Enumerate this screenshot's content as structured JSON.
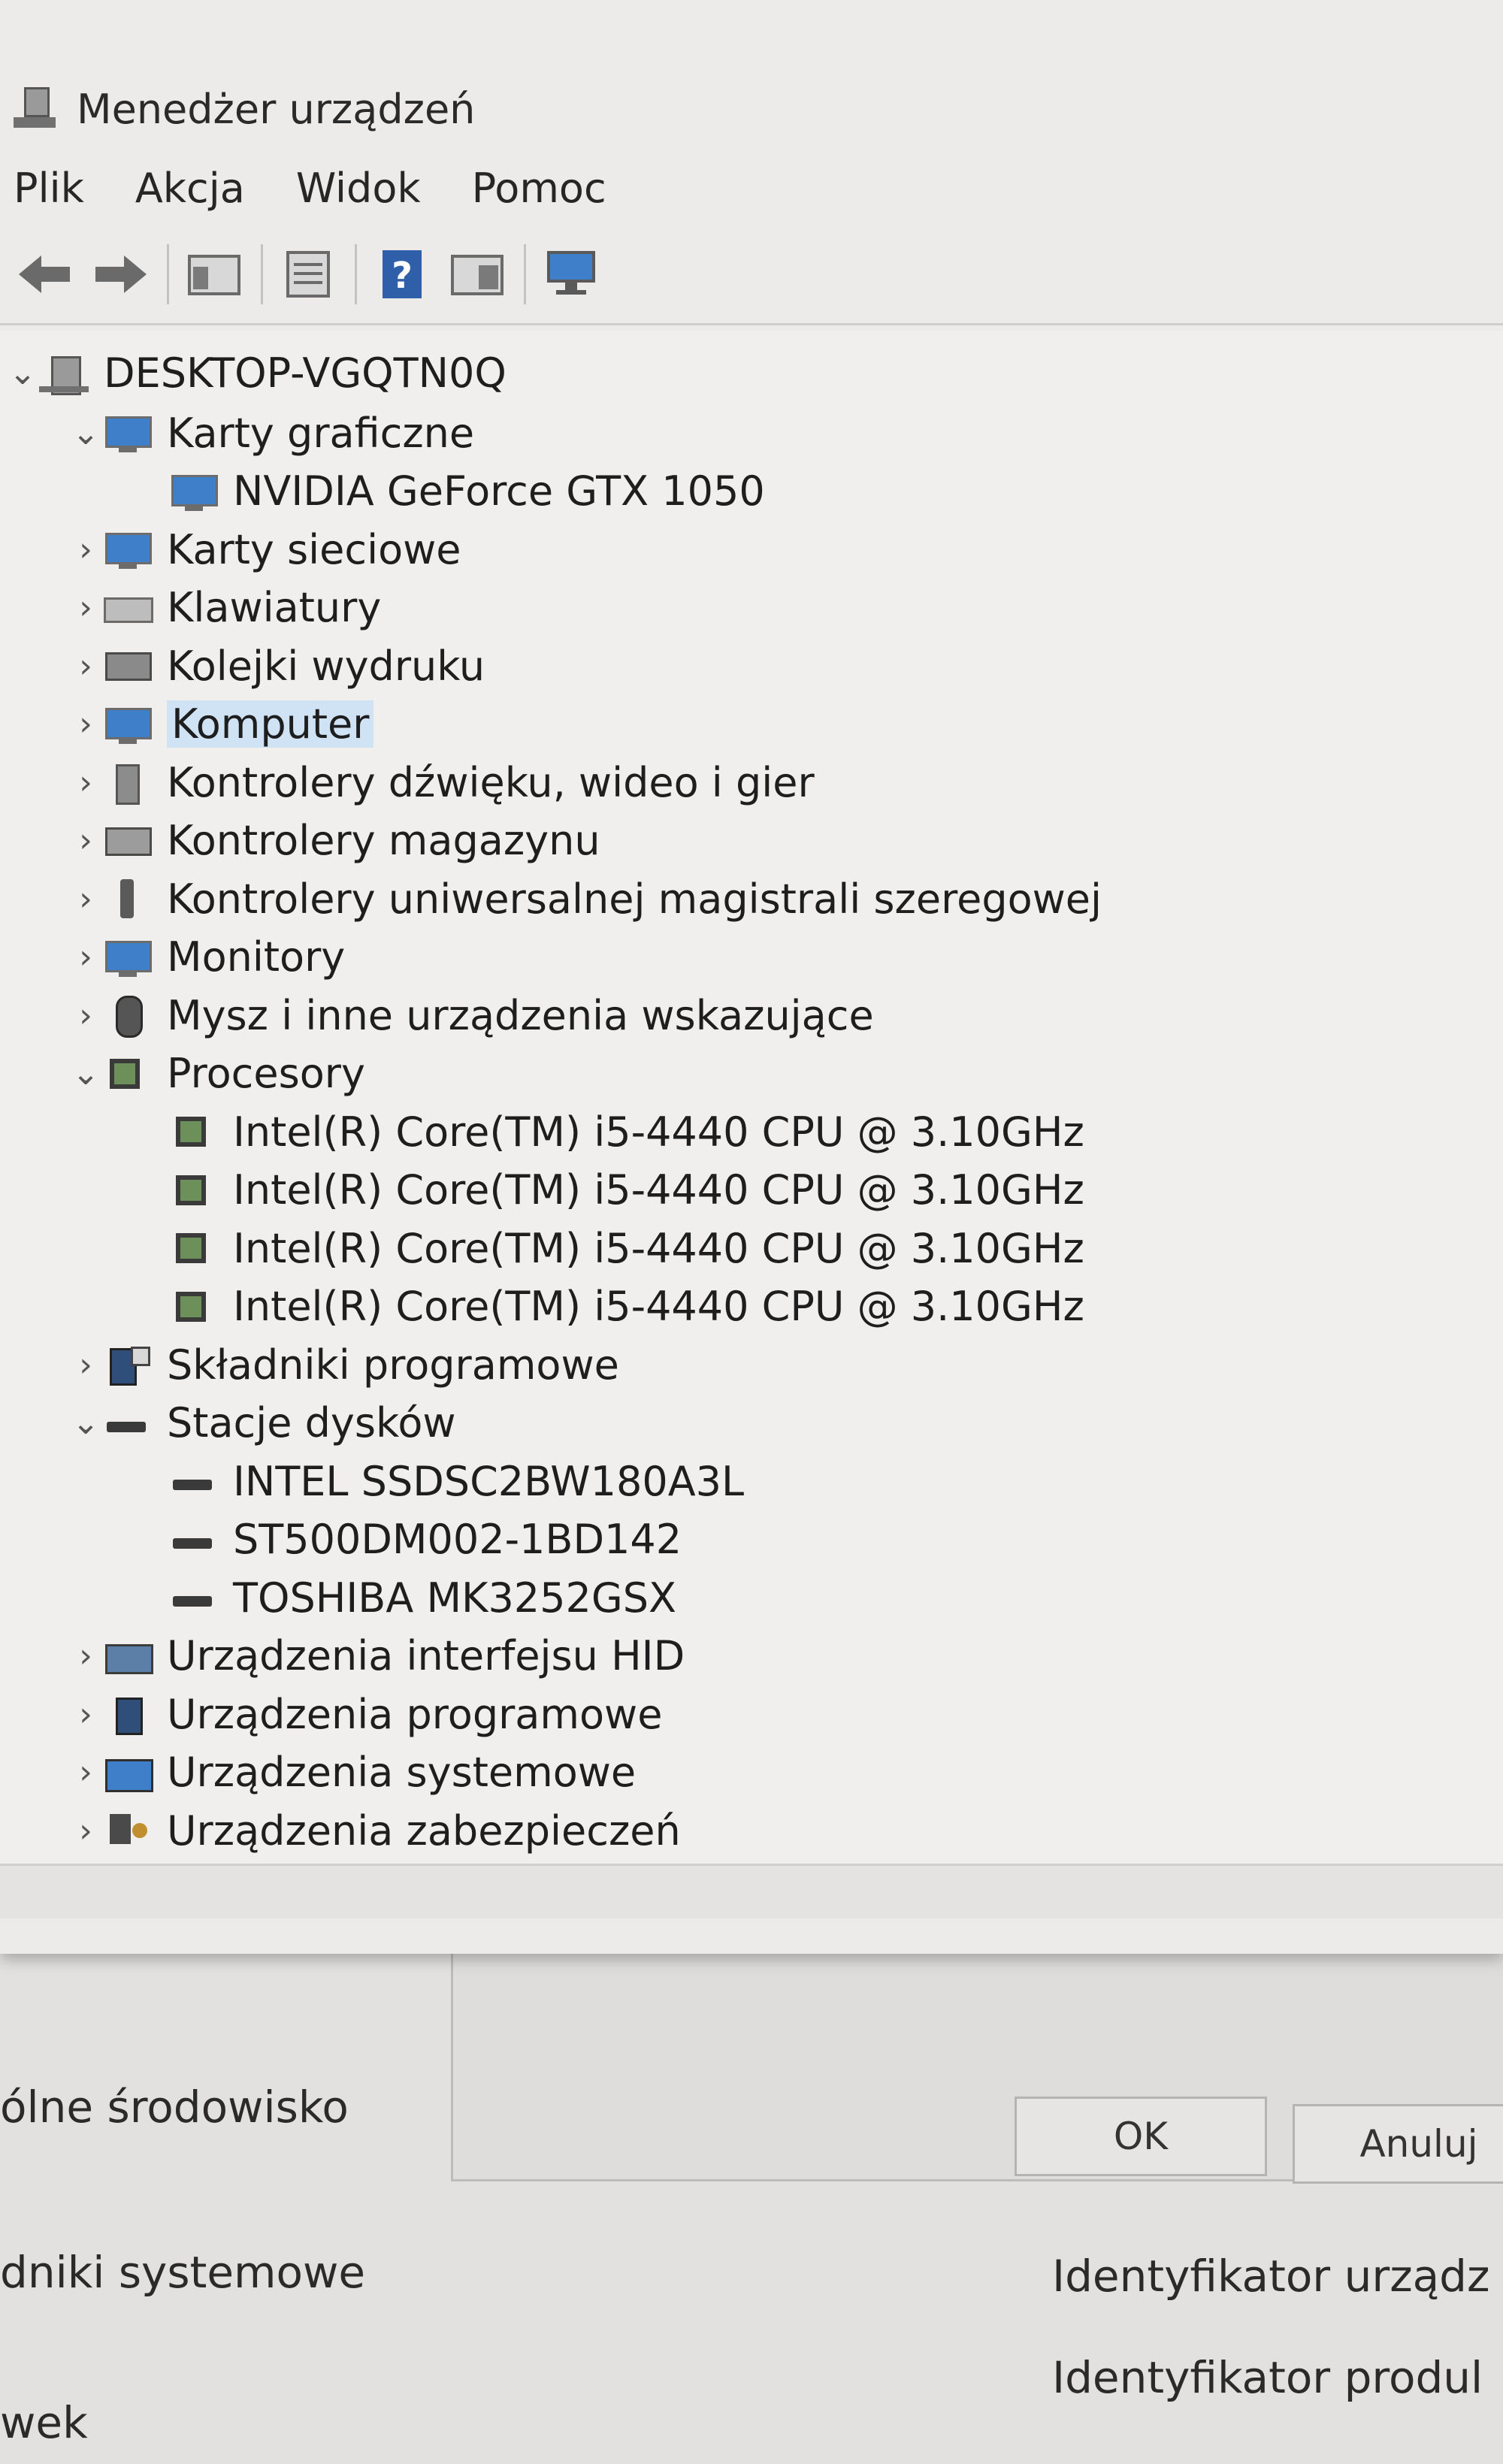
{
  "window": {
    "title": "Menedżer urządzeń"
  },
  "menu": [
    "Plik",
    "Akcja",
    "Widok",
    "Pomoc"
  ],
  "tree": {
    "root": "DESKTOP-VGQTN0Q",
    "rows": [
      {
        "label": "Karty graficzne",
        "icon": "display-adapter-icon",
        "state": "expanded",
        "level": 1
      },
      {
        "label": "NVIDIA GeForce GTX 1050",
        "icon": "display-adapter-icon",
        "state": "leaf",
        "level": 2
      },
      {
        "label": "Karty sieciowe",
        "icon": "network-adapter-icon",
        "state": "collapsed",
        "level": 1
      },
      {
        "label": "Klawiatury",
        "icon": "keyboard-icon",
        "state": "collapsed",
        "level": 1
      },
      {
        "label": "Kolejki wydruku",
        "icon": "printer-icon",
        "state": "collapsed",
        "level": 1
      },
      {
        "label": "Komputer",
        "icon": "computer-icon",
        "state": "collapsed",
        "level": 1,
        "selected": true
      },
      {
        "label": "Kontrolery dźwięku, wideo i gier",
        "icon": "speaker-icon",
        "state": "collapsed",
        "level": 1
      },
      {
        "label": "Kontrolery magazynu",
        "icon": "storage-controller-icon",
        "state": "collapsed",
        "level": 1
      },
      {
        "label": "Kontrolery uniwersalnej magistrali szeregowej",
        "icon": "usb-icon",
        "state": "collapsed",
        "level": 1
      },
      {
        "label": "Monitory",
        "icon": "monitor-icon",
        "state": "collapsed",
        "level": 1
      },
      {
        "label": "Mysz i inne urządzenia wskazujące",
        "icon": "mouse-icon",
        "state": "collapsed",
        "level": 1
      },
      {
        "label": "Procesory",
        "icon": "processor-icon",
        "state": "expanded",
        "level": 1
      },
      {
        "label": "Intel(R) Core(TM) i5-4440 CPU @ 3.10GHz",
        "icon": "processor-icon",
        "state": "leaf",
        "level": 2
      },
      {
        "label": "Intel(R) Core(TM) i5-4440 CPU @ 3.10GHz",
        "icon": "processor-icon",
        "state": "leaf",
        "level": 2
      },
      {
        "label": "Intel(R) Core(TM) i5-4440 CPU @ 3.10GHz",
        "icon": "processor-icon",
        "state": "leaf",
        "level": 2
      },
      {
        "label": "Intel(R) Core(TM) i5-4440 CPU @ 3.10GHz",
        "icon": "processor-icon",
        "state": "leaf",
        "level": 2
      },
      {
        "label": "Składniki programowe",
        "icon": "software-component-icon",
        "state": "collapsed",
        "level": 1
      },
      {
        "label": "Stacje dysków",
        "icon": "disk-drive-icon",
        "state": "expanded",
        "level": 1
      },
      {
        "label": "INTEL SSDSC2BW180A3L",
        "icon": "disk-drive-icon",
        "state": "leaf",
        "level": 2
      },
      {
        "label": "ST500DM002-1BD142",
        "icon": "disk-drive-icon",
        "state": "leaf",
        "level": 2
      },
      {
        "label": "TOSHIBA MK3252GSX",
        "icon": "disk-drive-icon",
        "state": "leaf",
        "level": 2
      },
      {
        "label": "Urządzenia interfejsu HID",
        "icon": "hid-icon",
        "state": "collapsed",
        "level": 1
      },
      {
        "label": "Urządzenia programowe",
        "icon": "software-device-icon",
        "state": "collapsed",
        "level": 1
      },
      {
        "label": "Urządzenia systemowe",
        "icon": "system-devices-icon",
        "state": "collapsed",
        "level": 1
      },
      {
        "label": "Urządzenia zabezpieczeń",
        "icon": "security-device-icon",
        "state": "collapsed",
        "level": 1
      }
    ]
  },
  "background": {
    "left_items": [
      "ólne środowisko",
      "dniki systemowe",
      "wek"
    ],
    "ok_label": "OK",
    "cancel_label": "Anuluj",
    "right_items": [
      "Identyfikator urządz",
      "Identyfikator produl"
    ]
  }
}
